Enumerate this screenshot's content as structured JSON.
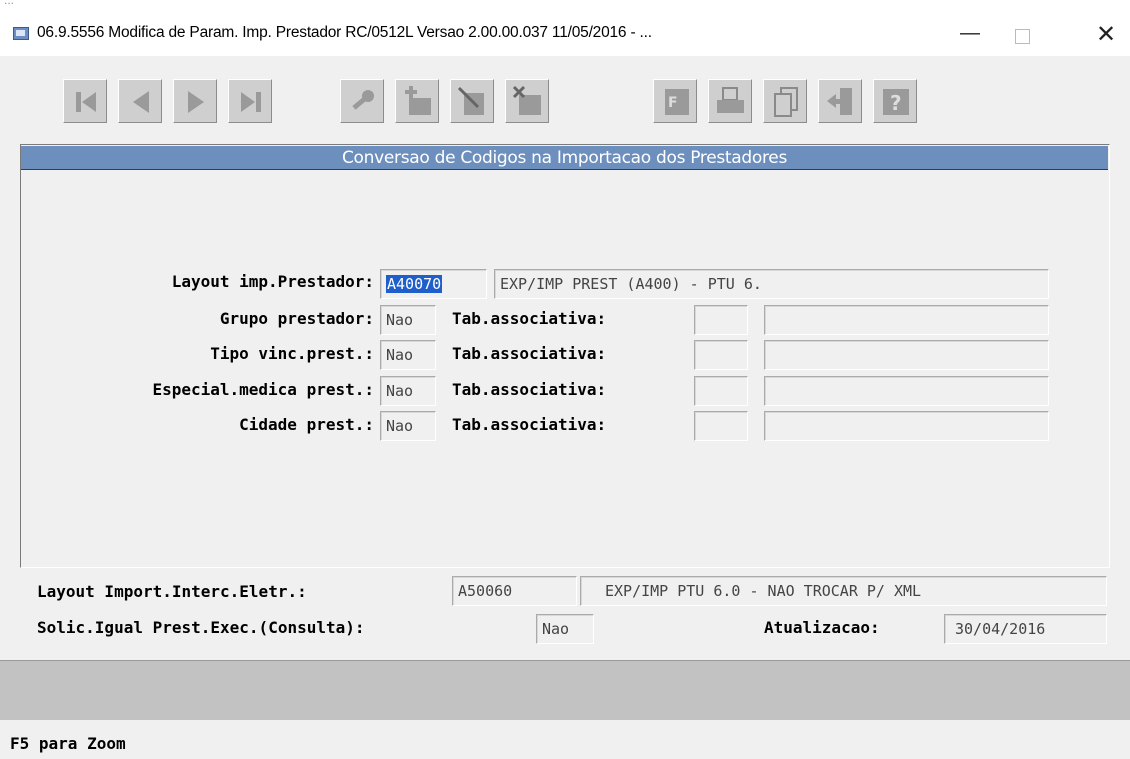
{
  "window": {
    "behind_title": "...",
    "title": "06.9.5556  Modifica  de Param. Imp. Prestador RC/0512L Versao 2.00.00.037 11/05/2016 - ...",
    "minimize": "—",
    "close": "✕"
  },
  "toolbar": {
    "buttons": [
      "first-record",
      "previous-record",
      "next-record",
      "last-record",
      "search",
      "add",
      "modify",
      "delete",
      "filter",
      "print",
      "copy",
      "exit",
      "help"
    ]
  },
  "section": {
    "title": "Conversao de Codigos na Importacao dos Prestadores",
    "layout_label": "Layout imp.Prestador:",
    "layout_code": "A40070",
    "layout_desc": "EXP/IMP PREST (A400) - PTU 6.",
    "rows": [
      {
        "label": "Grupo prestador:",
        "value": "Nao",
        "tab_label": "Tab.associativa:",
        "tab_code": "",
        "tab_desc": ""
      },
      {
        "label": "Tipo vinc.prest.:",
        "value": "Nao",
        "tab_label": "Tab.associativa:",
        "tab_code": "",
        "tab_desc": ""
      },
      {
        "label": "Especial.medica prest.:",
        "value": "Nao",
        "tab_label": "Tab.associativa:",
        "tab_code": "",
        "tab_desc": ""
      },
      {
        "label": "Cidade prest.:",
        "value": "Nao",
        "tab_label": "Tab.associativa:",
        "tab_code": "",
        "tab_desc": ""
      }
    ]
  },
  "lower": {
    "import_label": "Layout Import.Interc.Eletr.:",
    "import_code": "A50060",
    "import_desc": "EXP/IMP PTU 6.0 - NAO TROCAR P/ XML",
    "solic_label": "Solic.Igual Prest.Exec.(Consulta):",
    "solic_value": "Nao",
    "atualizacao_label": "Atualizacao:",
    "atualizacao_value": "30/04/2016"
  },
  "status": {
    "hint": "F5 para Zoom"
  }
}
